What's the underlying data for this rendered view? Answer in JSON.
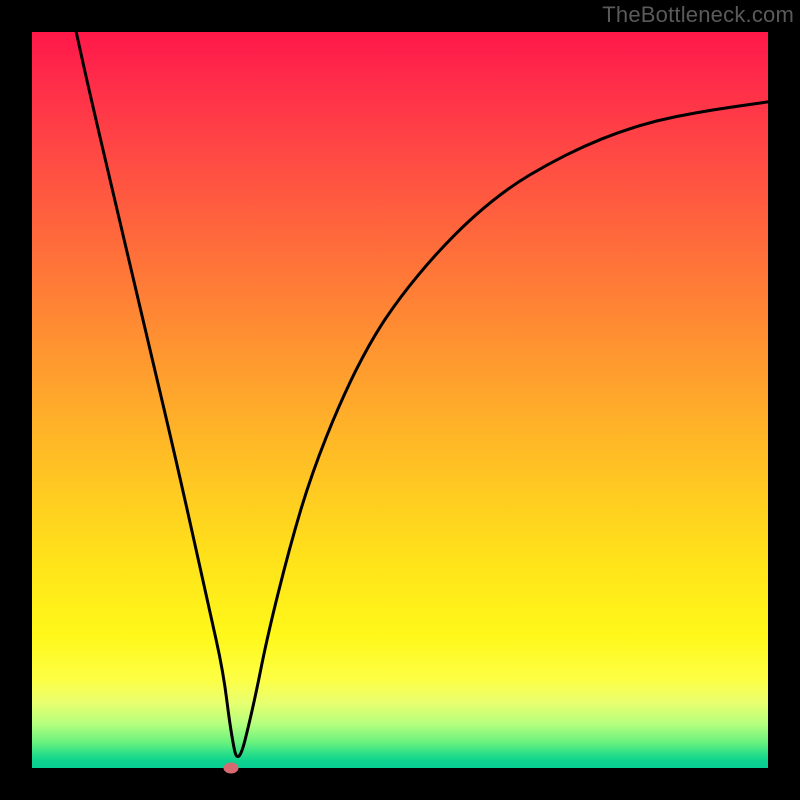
{
  "watermark_text": "TheBottleneck.com",
  "chart_data": {
    "type": "line",
    "title": "",
    "xlabel": "",
    "ylabel": "",
    "xlim": [
      0,
      100
    ],
    "ylim": [
      0,
      100
    ],
    "grid": false,
    "series": [
      {
        "name": "curve",
        "x": [
          6,
          8,
          12,
          16,
          20,
          24,
          26,
          27,
          28,
          30,
          32,
          35,
          38,
          42,
          46,
          50,
          55,
          60,
          65,
          70,
          75,
          80,
          85,
          90,
          95,
          100
        ],
        "y": [
          100,
          91,
          74,
          57,
          40,
          22,
          13,
          5,
          0,
          8,
          18,
          30,
          40,
          50,
          58,
          64,
          70,
          75,
          79,
          82,
          84.5,
          86.5,
          88,
          89,
          89.8,
          90.5
        ]
      }
    ],
    "marker": {
      "x": 27,
      "y": 0
    },
    "gradient_stops": [
      {
        "pct": 0,
        "color": "#ff1849"
      },
      {
        "pct": 45,
        "color": "#ff9a2f"
      },
      {
        "pct": 82,
        "color": "#fff81a"
      },
      {
        "pct": 100,
        "color": "#07cf92"
      }
    ]
  }
}
